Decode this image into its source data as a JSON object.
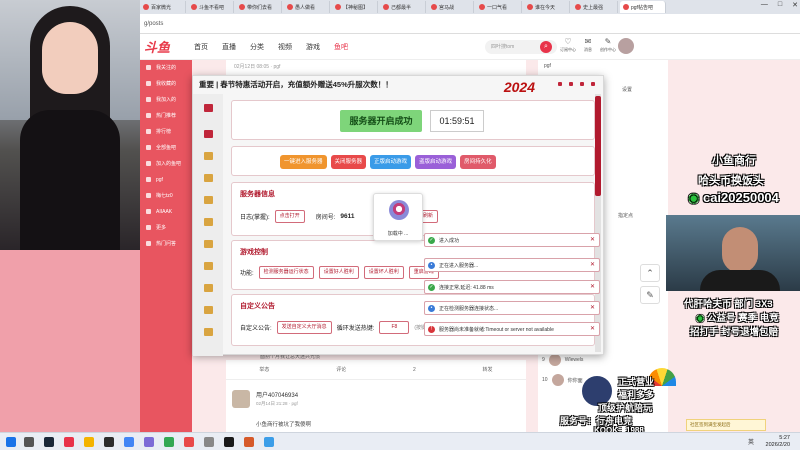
{
  "browser": {
    "tabs": [
      "百家微光",
      "斗鱼不看吧",
      "带你们去看",
      "愚人做看",
      "【神秘图】",
      "己都最半",
      "宫马战",
      "一口气看",
      "谁在今天",
      "史上最强",
      "pgf帖告吧"
    ],
    "active_tab": "pgf帖告吧",
    "url": "g/posts",
    "window_controls": [
      "—",
      "□",
      "✕"
    ]
  },
  "site": {
    "logo": "斗鱼",
    "nav": [
      "首页",
      "直播",
      "分类",
      "视频",
      "游戏",
      "鱼吧"
    ],
    "nav_active": "鱼吧",
    "search_placeholder": "四叶搜tom",
    "header_icons": [
      "订阅中心",
      "消息",
      "创作中心"
    ],
    "sidebar": [
      "我关注的",
      "我收藏的",
      "我加入的",
      "热门推荐",
      "排行榜",
      "全部鱼吧",
      "加入的鱼吧",
      "pgf",
      "梅七tz0",
      "AIIAAK",
      "更多",
      "热门问答"
    ],
    "post_top_meta": "02月12日 08:05 · pgf",
    "right_top": "pgf",
    "right_settings": "设置",
    "right_tag": "指定点",
    "post_preview": "面别个月我让总大迷兴光惯",
    "actions": [
      "举态",
      "评论",
      "2",
      "转发"
    ],
    "reply_user": "用户407046934",
    "reply_time": "02月14日 21:28 · pgf",
    "reply_text": "小鱼商行被坑了我傻啊",
    "right_rows": [
      {
        "num": "9",
        "name": "Wlewels"
      },
      {
        "num": "10",
        "name": "你你面"
      }
    ]
  },
  "dialog": {
    "title": "重要 | 春节特惠活动开启，充值额外赠送45%升服次数！！",
    "logo_text": "2024",
    "status": "服务器开启成功",
    "timer": "01:59:51",
    "quick_buttons": [
      {
        "label": "一键进入服务器",
        "color": "#f0952e"
      },
      {
        "label": "关闭服务器",
        "color": "#e84a4a"
      },
      {
        "label": "正版启动游戏",
        "color": "#3a9be8"
      },
      {
        "label": "盗版启动游戏",
        "color": "#9a60d8"
      },
      {
        "label": "房间持久化",
        "color": "#e05a6a"
      }
    ],
    "server_info": {
      "title": "服务器信息",
      "log_label": "日志(掌握):",
      "log_btn": "点击打开",
      "room_label": "房间号:",
      "room_value": "9611",
      "refresh_btn": "刷新"
    },
    "game_control": {
      "title": "游戏控制",
      "label": "功能:",
      "buttons": [
        "检测服务器运行状态",
        "设置好人胜利",
        "设置坏人胜利",
        "重启游戏"
      ]
    },
    "announcement": {
      "title": "自定义公告",
      "label": "自定义公告:",
      "send_btn": "发送自定义大厅消息",
      "loop_label": "循环发送热键:",
      "hotkey": "F8",
      "hint": "(按键发送大厅公告栏上)"
    },
    "loading_text": "加载中 ..."
  },
  "toasts": [
    {
      "icon": "check",
      "text": "进入成功"
    },
    {
      "icon": "info",
      "text": "正在进入服务器..."
    },
    {
      "icon": "check",
      "text": "连接正常,延迟: 41.88 ms"
    },
    {
      "icon": "info",
      "text": "正在检测服务器连接状态..."
    },
    {
      "icon": "error",
      "text": "服务器尚未准备就绪:Timeout or server not available"
    }
  ],
  "overlay": {
    "line1": "小鱼商行",
    "line2": "哈头币换饭头",
    "wechat": "cai20250004",
    "promo1": "代肝哈夫币 部门 3X3",
    "promo2": "公益号 赛季 电竞",
    "promo3": "招打手 封号退增包赔",
    "badge1": "正式营业",
    "badge2": "福利多多",
    "badge3": "顶级护航陪玩",
    "service": "服务号：行舟电竞",
    "kook": "KOOK：1988",
    "note": "社区签到满宝发起后"
  },
  "taskbar": {
    "time": "5:27",
    "date": "2026/2/20",
    "lang": "英"
  }
}
